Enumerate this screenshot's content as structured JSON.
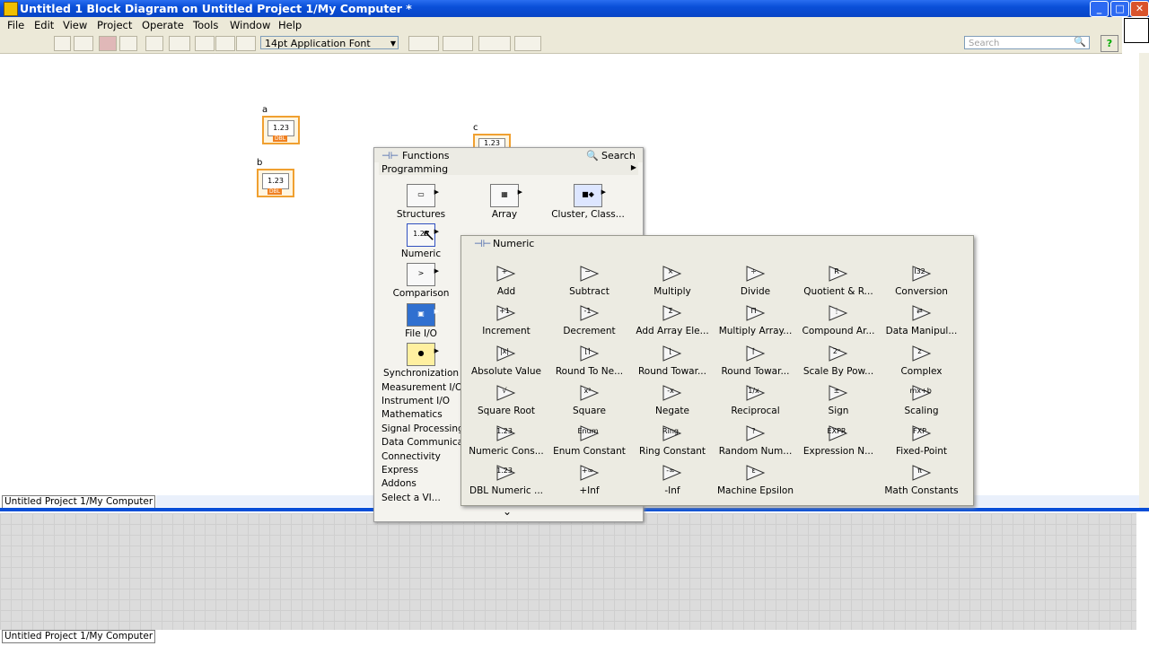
{
  "window": {
    "title": "Untitled 1 Block Diagram on Untitled Project 1/My Computer *",
    "min": "_",
    "max": "□",
    "close": "✕"
  },
  "menu": [
    "File",
    "Edit",
    "View",
    "Project",
    "Operate",
    "Tools",
    "Window",
    "Help"
  ],
  "toolbar": {
    "font": "14pt Application Font",
    "search_placeholder": "Search",
    "help": "?"
  },
  "diagram": {
    "controls": [
      {
        "label": "a",
        "value": "1.23"
      },
      {
        "label": "b",
        "value": "1.23"
      },
      {
        "label": "c",
        "value": "1.23"
      }
    ],
    "dbl": "DBL"
  },
  "status": {
    "top": "Untitled Project 1/My Computer",
    "bottom": "Untitled Project 1/My Computer"
  },
  "functions_palette": {
    "title": "Functions",
    "search": "Search",
    "category": "Programming",
    "items": [
      {
        "label": "Structures",
        "icon": "structures-icon"
      },
      {
        "label": "Array",
        "icon": "array-icon"
      },
      {
        "label": "Cluster, Class...",
        "icon": "cluster-icon"
      },
      {
        "label": "Numeric",
        "icon": "numeric-icon"
      },
      {
        "label": "Comparison",
        "icon": "comparison-icon"
      },
      {
        "label": "File I/O",
        "icon": "file-io-icon"
      },
      {
        "label": "Synchronization",
        "icon": "synchronization-icon"
      }
    ],
    "categories": [
      "Measurement I/O",
      "Instrument I/O",
      "Mathematics",
      "Signal Processing",
      "Data Communica",
      "Connectivity",
      "Express",
      "Addons",
      "Select a VI..."
    ],
    "expand": "⌄"
  },
  "numeric_palette": {
    "title": "Numeric",
    "items": [
      "Add",
      "Subtract",
      "Multiply",
      "Divide",
      "Quotient & R...",
      "Conversion",
      "Increment",
      "Decrement",
      "Add Array Ele...",
      "Multiply Array...",
      "Compound Ar...",
      "Data Manipul...",
      "Absolute Value",
      "Round To Ne...",
      "Round Towar...",
      "Round Towar...",
      "Scale By Pow...",
      "Complex",
      "Square Root",
      "Square",
      "Negate",
      "Reciprocal",
      "Sign",
      "Scaling",
      "Numeric Cons...",
      "Enum Constant",
      "Ring Constant",
      "Random Num...",
      "Expression N...",
      "Fixed-Point",
      "DBL Numeric ...",
      "+Inf",
      "-Inf",
      "Machine Epsilon",
      "",
      "Math Constants"
    ],
    "glyphs": [
      "+",
      "−",
      "×",
      "÷",
      "R",
      "I32",
      "+1",
      "-1",
      "Σ",
      "Π",
      "⋮",
      "⇄",
      "|x|",
      "⌊⌉",
      "⌊",
      "⌈",
      "2ⁿ",
      "z",
      "√",
      "x²",
      "-x",
      "1/x",
      "±",
      "mx+b",
      "1.23",
      "Enum",
      "Ring",
      "?",
      "EXPR",
      "FXP",
      "1.23",
      "+∞",
      "-∞",
      "ε",
      "",
      "π"
    ]
  },
  "colors": {
    "title_bar": "#0a4fd8",
    "chrome": "#ece9d8",
    "control_border": "#f0a030"
  }
}
